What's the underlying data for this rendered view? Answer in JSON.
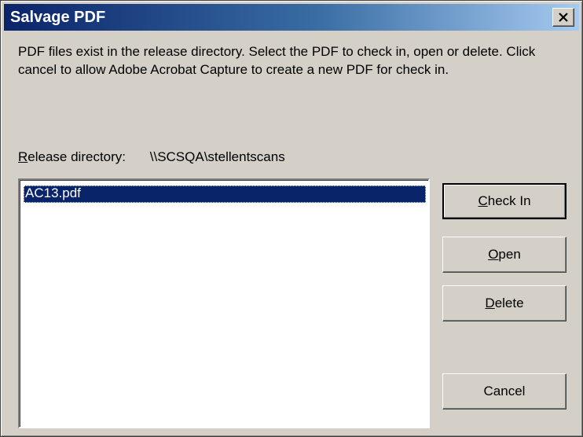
{
  "window": {
    "title": "Salvage PDF",
    "close_glyph": "✕"
  },
  "message": "PDF files exist in the release directory.  Select the PDF to check in, open or delete.  Click cancel to allow Adobe Acrobat Capture to create a new PDF for check in.",
  "release": {
    "label_mnemonic": "R",
    "label_rest": "elease directory:",
    "value": "\\\\SCSQA\\stellentscans"
  },
  "files": [
    {
      "name": "AC13.pdf",
      "selected": true
    }
  ],
  "buttons": {
    "check_in": {
      "mnemonic": "C",
      "rest": "heck In"
    },
    "open": {
      "mnemonic": "O",
      "rest": "pen"
    },
    "delete": {
      "mnemonic": "D",
      "rest": "elete"
    },
    "cancel": {
      "label": "Cancel"
    }
  },
  "colors": {
    "title_start": "#0a246a",
    "title_end": "#a6caf0",
    "selection": "#0a246a",
    "dialog_face": "#d4d0c8"
  }
}
